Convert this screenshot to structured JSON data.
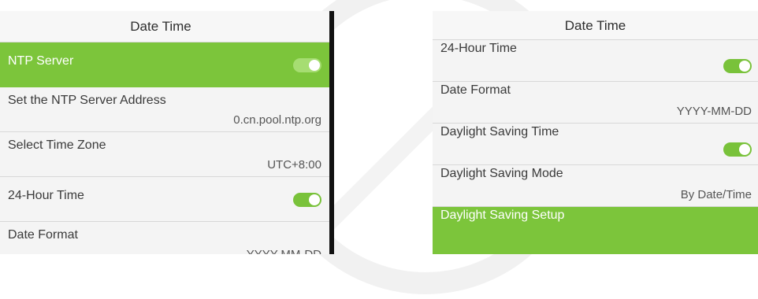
{
  "left_screen": {
    "title": "Date Time",
    "rows": [
      {
        "label": "NTP Server",
        "type": "toggle",
        "on": true,
        "highlighted": true
      },
      {
        "label": "Set the NTP Server Address",
        "value": "0.cn.pool.ntp.org"
      },
      {
        "label": "Select Time Zone",
        "value": "UTC+8:00"
      },
      {
        "label": "24-Hour Time",
        "type": "toggle",
        "on": true
      },
      {
        "label": "Date Format",
        "value": "YYYY-MM-DD"
      }
    ]
  },
  "right_screen": {
    "title": "Date Time",
    "rows": [
      {
        "label": "24-Hour Time",
        "type": "toggle",
        "on": true
      },
      {
        "label": "Date Format",
        "value": "YYYY-MM-DD"
      },
      {
        "label": "Daylight Saving Time",
        "type": "toggle",
        "on": true
      },
      {
        "label": "Daylight Saving Mode",
        "value": "By Date/Time"
      },
      {
        "label": "Daylight Saving Setup",
        "highlighted": true
      }
    ]
  },
  "colors": {
    "highlight": "#7cc53b",
    "toggle_on": "#79c23a",
    "background": "#f4f4f4"
  }
}
